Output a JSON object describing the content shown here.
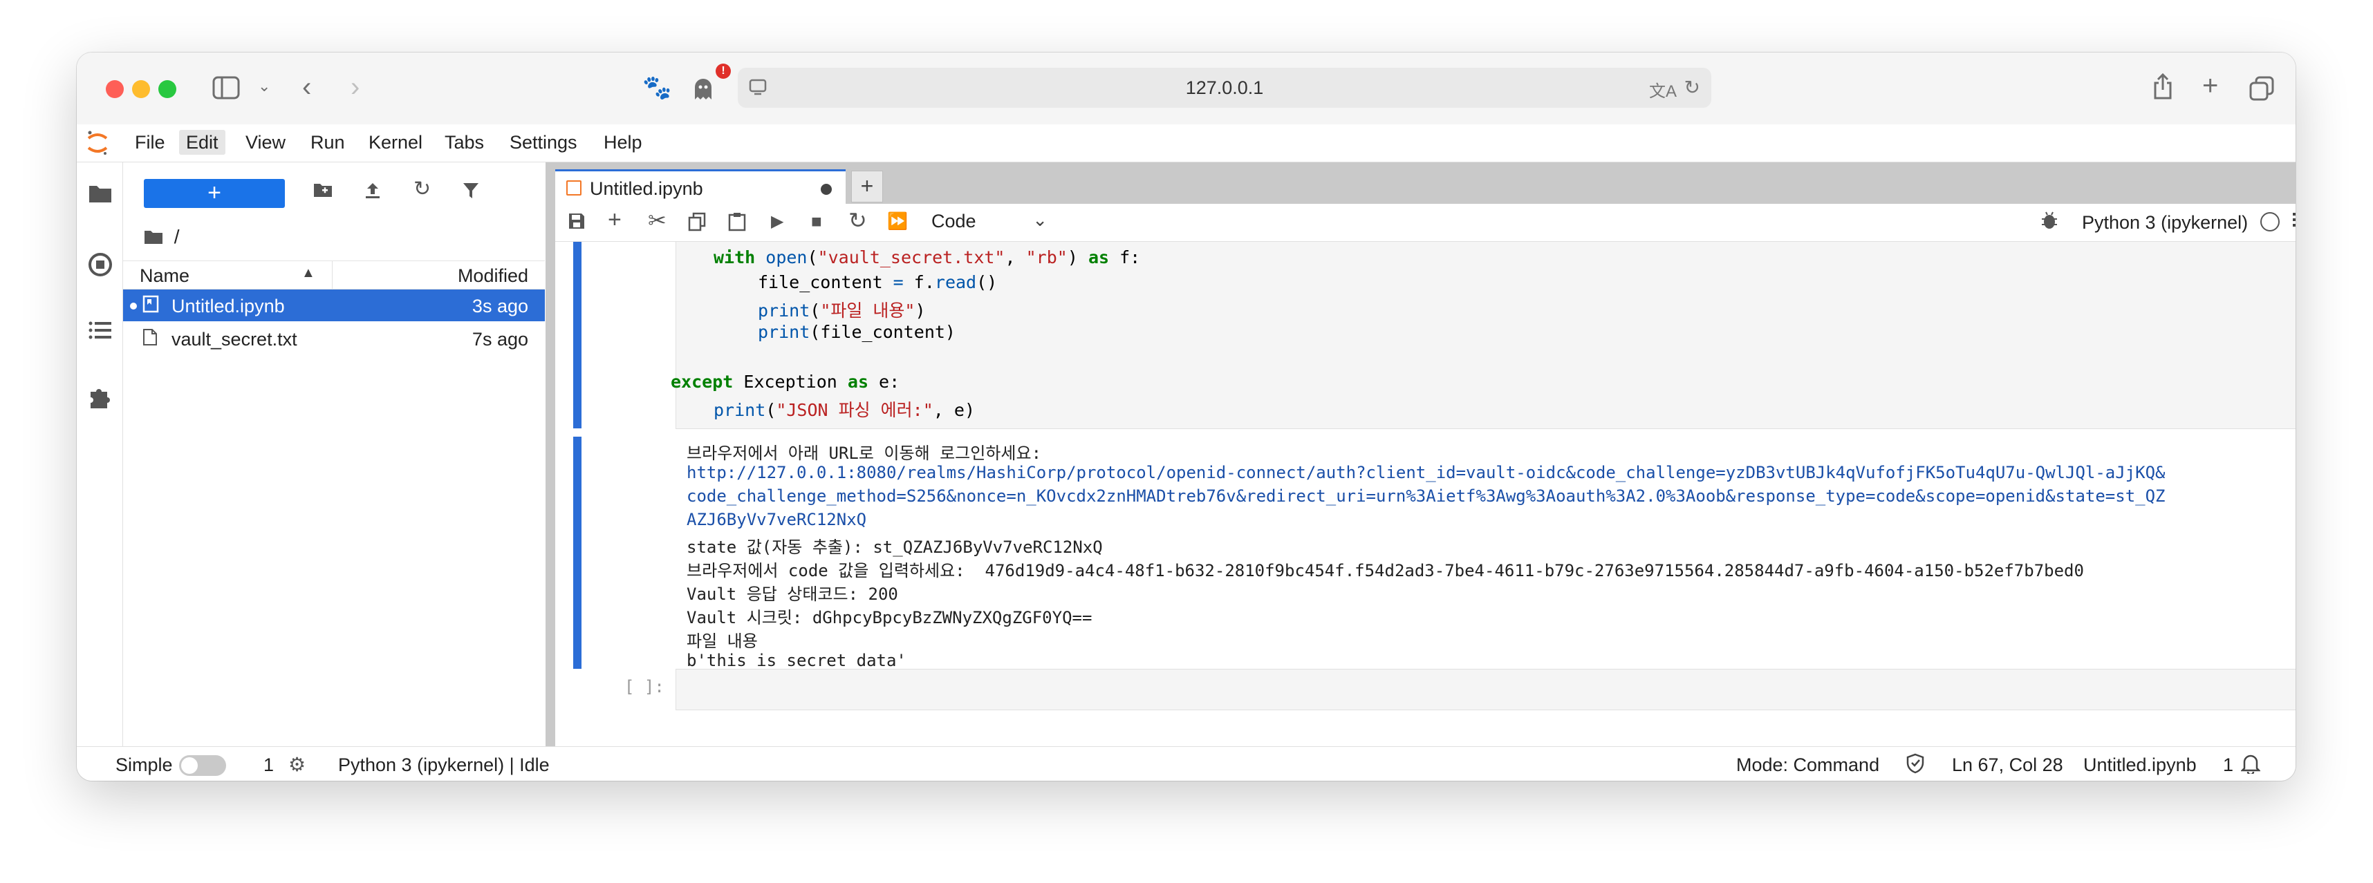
{
  "browser": {
    "url": "127.0.0.1",
    "notification_badge": "!"
  },
  "menu": {
    "items": [
      "File",
      "Edit",
      "View",
      "Run",
      "Kernel",
      "Tabs",
      "Settings",
      "Help"
    ],
    "active": "Edit"
  },
  "filebrowser": {
    "new_button": "+",
    "path": "/",
    "col_name": "Name",
    "col_modified": "Modified",
    "files": [
      {
        "name": "Untitled.ipynb",
        "modified": "3s ago",
        "type": "notebook",
        "selected": true
      },
      {
        "name": "vault_secret.txt",
        "modified": "7s ago",
        "type": "file",
        "selected": false
      }
    ]
  },
  "notebook": {
    "tab_label": "Untitled.ipynb",
    "add_tab": "+",
    "cell_type": "Code",
    "kernel": "Python 3 (ipykernel)",
    "code": {
      "line1": {
        "kw_with": "with",
        "fn_open": "open",
        "paren_open": "(",
        "str_file": "\"vault_secret.txt\"",
        "comma": ", ",
        "str_mode": "\"rb\"",
        "paren_close": ") ",
        "kw_as": "as",
        "rest": " f:"
      },
      "line2": {
        "a": "file_content ",
        "op": "=",
        "b": " f.",
        "fn": "read",
        "c": "()"
      },
      "line3": {
        "fn": "print",
        "a": "(",
        "str": "\"파일 내용\"",
        "b": ")"
      },
      "line4": {
        "fn": "print",
        "a": "(file_content)"
      },
      "line5": {
        "kw_except": "except",
        "a": " Exception ",
        "kw_as": "as",
        "b": " e:"
      },
      "line6": {
        "fn": "print",
        "a": "(",
        "str": "\"JSON 파싱 에러:\"",
        "b": ", e)"
      }
    },
    "output": [
      "브라우저에서 아래 URL로 이동해 로그인하세요:",
      "http://127.0.0.1:8080/realms/HashiCorp/protocol/openid-connect/auth?client_id=vault-oidc&code_challenge=yzDB3vtUBJk4qVufofjFK5oTu4qU7u-QwlJQl-aJjKQ&",
      "code_challenge_method=S256&nonce=n_KOvcdx2znHMADtreb76v&redirect_uri=urn%3Aietf%3Awg%3Aoauth%3A2.0%3Aoob&response_type=code&scope=openid&state=st_QZ",
      "AZJ6ByVv7veRC12NxQ",
      "state 값(자동 추출): st_QZAZJ6ByVv7veRC12NxQ",
      "브라우저에서 code 값을 입력하세요:  476d19d9-a4c4-48f1-b632-2810f9bc454f.f54d2ad3-7be4-4611-b79c-2763e9715564.285844d7-a9fb-4604-a150-b52ef7b7bed0",
      "Vault 응답 상태코드: 200",
      "Vault 시크릿: dGhpcyBpcyBzZWNyZXQgZGF0YQ==",
      "파일 내용",
      "b'this is secret data'"
    ],
    "empty_prompt": "[ ]:"
  },
  "status": {
    "mode_label": "Simple",
    "terminals": "1",
    "kernel_status": "Python 3 (ipykernel) | Idle",
    "mode": "Mode: Command",
    "position": "Ln 67, Col 28",
    "filename": "Untitled.ipynb",
    "notifications": "1"
  },
  "colors": {
    "accent": "#2c6dd6",
    "keyword": "#008000",
    "string": "#ba2121",
    "link": "#1a4fa8"
  }
}
